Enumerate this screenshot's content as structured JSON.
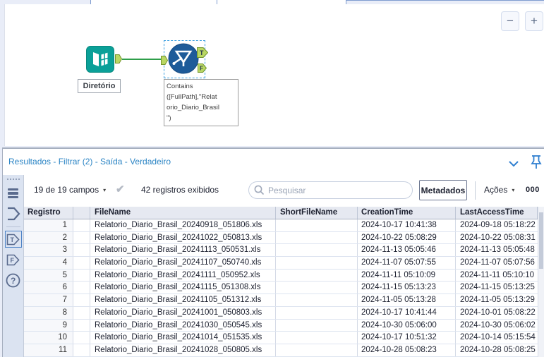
{
  "canvas": {
    "directory_tool": {
      "label": "Diretório"
    },
    "filter_tool": {
      "annotation": "Contains\n([FullPath],\"Relat\norio_Diario_Brasil\n\")",
      "true_anchor": "T",
      "false_anchor": "F"
    },
    "zoom_out": "−",
    "zoom_in": "+"
  },
  "results_panel": {
    "title": "Resultados - Filtrar (2) - Saída - Verdadeiro",
    "toolbar": {
      "fields_summary": "19 de 19 campos",
      "records_summary": "42 registros exibidos",
      "search_placeholder": "Pesquisar",
      "metadata_button": "Metadados",
      "actions_label": "Ações",
      "cell_viewer_label": "000"
    },
    "anchors": {
      "true": "T",
      "false": "F",
      "help": "?"
    },
    "table": {
      "columns": [
        "Registro",
        "",
        "FileName",
        "ShortFileName",
        "CreationTime",
        "LastAccessTime"
      ],
      "rows": [
        {
          "registro": "1",
          "file_name": "Relatorio_Diario_Brasil_20240918_051806.xls",
          "short_file_name": "",
          "creation_time": "2024-10-17 10:41:38",
          "last_access_time": "2024-09-18 05:18:22"
        },
        {
          "registro": "2",
          "file_name": "Relatorio_Diario_Brasil_20241022_050813.xls",
          "short_file_name": "",
          "creation_time": "2024-10-22 05:08:29",
          "last_access_time": "2024-10-22 05:08:31"
        },
        {
          "registro": "3",
          "file_name": "Relatorio_Diario_Brasil_20241113_050531.xls",
          "short_file_name": "",
          "creation_time": "2024-11-13 05:05:46",
          "last_access_time": "2024-11-13 05:05:48"
        },
        {
          "registro": "4",
          "file_name": "Relatorio_Diario_Brasil_20241107_050740.xls",
          "short_file_name": "",
          "creation_time": "2024-11-07 05:07:55",
          "last_access_time": "2024-11-07 05:07:56"
        },
        {
          "registro": "5",
          "file_name": "Relatorio_Diario_Brasil_20241111_050952.xls",
          "short_file_name": "",
          "creation_time": "2024-11-11 05:10:09",
          "last_access_time": "2024-11-11 05:10:10"
        },
        {
          "registro": "6",
          "file_name": "Relatorio_Diario_Brasil_20241115_051308.xls",
          "short_file_name": "",
          "creation_time": "2024-11-15 05:13:23",
          "last_access_time": "2024-11-15 05:13:25"
        },
        {
          "registro": "7",
          "file_name": "Relatorio_Diario_Brasil_20241105_051312.xls",
          "short_file_name": "",
          "creation_time": "2024-11-05 05:13:28",
          "last_access_time": "2024-11-05 05:13:29"
        },
        {
          "registro": "8",
          "file_name": "Relatorio_Diario_Brasil_20241001_050803.xls",
          "short_file_name": "",
          "creation_time": "2024-10-17 10:41:44",
          "last_access_time": "2024-10-01 05:08:22"
        },
        {
          "registro": "9",
          "file_name": "Relatorio_Diario_Brasil_20241030_050545.xls",
          "short_file_name": "",
          "creation_time": "2024-10-30 05:06:00",
          "last_access_time": "2024-10-30 05:06:02"
        },
        {
          "registro": "10",
          "file_name": "Relatorio_Diario_Brasil_20241014_051535.xls",
          "short_file_name": "",
          "creation_time": "2024-10-17 10:51:32",
          "last_access_time": "2024-10-14 05:15:54"
        },
        {
          "registro": "11",
          "file_name": "Relatorio_Diario_Brasil_20241028_050805.xls",
          "short_file_name": "",
          "creation_time": "2024-10-28 05:08:23",
          "last_access_time": "2024-10-28 05:08:25"
        }
      ]
    }
  }
}
